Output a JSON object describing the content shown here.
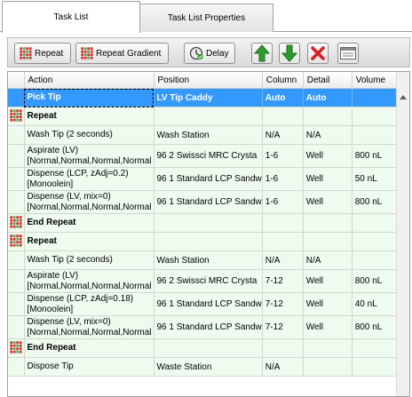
{
  "tabs": [
    {
      "label": "Task List",
      "active": true
    },
    {
      "label": "Task List Properties",
      "active": false
    }
  ],
  "toolbar": {
    "repeat_label": "Repeat",
    "repeat_gradient_label": "Repeat Gradient",
    "delay_label": "Delay",
    "move_up_icon": "arrow-up-icon",
    "move_down_icon": "arrow-down-icon",
    "delete_icon": "delete-x-icon",
    "properties_icon": "window-icon"
  },
  "colors": {
    "selection": "#3399ff",
    "row_background": "#eefbee",
    "move_arrow": "#2e9b2e",
    "delete": "#d81e1e"
  },
  "columns": [
    "Action",
    "Position",
    "Column",
    "Detail",
    "Volume"
  ],
  "rows": [
    {
      "type": "task",
      "selected": true,
      "action": [
        "Pick Tip"
      ],
      "position": "LV Tip Caddy",
      "column": "Auto",
      "detail": "Auto",
      "volume": ""
    },
    {
      "type": "repeat",
      "action": [
        "Repeat"
      ],
      "position": "",
      "column": "",
      "detail": "",
      "volume": ""
    },
    {
      "type": "task",
      "action": [
        "Wash Tip (2 seconds)"
      ],
      "position": "Wash Station",
      "column": "N/A",
      "detail": "N/A",
      "volume": ""
    },
    {
      "type": "task",
      "action": [
        "Aspirate (LV)",
        "[Normal,Normal,Normal,Normal"
      ],
      "position": "96 2 Swissci MRC Crysta",
      "column": "1-6",
      "detail": "Well",
      "volume": "800 nL"
    },
    {
      "type": "task",
      "action": [
        "Dispense (LCP, zAdj=0.2)",
        "[Monoolein]"
      ],
      "position": "96 1 Standard LCP Sandw",
      "column": "1-6",
      "detail": "Well",
      "volume": "50 nL"
    },
    {
      "type": "task",
      "action": [
        "Dispense (LV, mix=0)",
        "[Normal,Normal,Normal,Normal"
      ],
      "position": "96 1 Standard LCP Sandw",
      "column": "1-6",
      "detail": "Well",
      "volume": "800 nL"
    },
    {
      "type": "end",
      "action": [
        "End Repeat"
      ],
      "position": "",
      "column": "",
      "detail": "",
      "volume": ""
    },
    {
      "type": "repeat",
      "action": [
        "Repeat"
      ],
      "position": "",
      "column": "",
      "detail": "",
      "volume": ""
    },
    {
      "type": "task",
      "action": [
        "Wash Tip (2 seconds)"
      ],
      "position": "Wash Station",
      "column": "N/A",
      "detail": "N/A",
      "volume": ""
    },
    {
      "type": "task",
      "action": [
        "Aspirate (LV)",
        "[Normal,Normal,Normal,Normal"
      ],
      "position": "96 2 Swissci MRC Crysta",
      "column": "7-12",
      "detail": "Well",
      "volume": "800 nL"
    },
    {
      "type": "task",
      "action": [
        "Dispense (LCP, zAdj=0.18)",
        "[Monoolein]"
      ],
      "position": "96 1 Standard LCP Sandw",
      "column": "7-12",
      "detail": "Well",
      "volume": "40 nL"
    },
    {
      "type": "task",
      "action": [
        "Dispense (LV, mix=0)",
        "[Normal,Normal,Normal,Normal"
      ],
      "position": "96 1 Standard LCP Sandw",
      "column": "7-12",
      "detail": "Well",
      "volume": "800 nL"
    },
    {
      "type": "end",
      "action": [
        "End Repeat"
      ],
      "position": "",
      "column": "",
      "detail": "",
      "volume": ""
    },
    {
      "type": "task",
      "action": [
        "Dispose Tip"
      ],
      "position": "Waste Station",
      "column": "N/A",
      "detail": "",
      "volume": ""
    }
  ]
}
